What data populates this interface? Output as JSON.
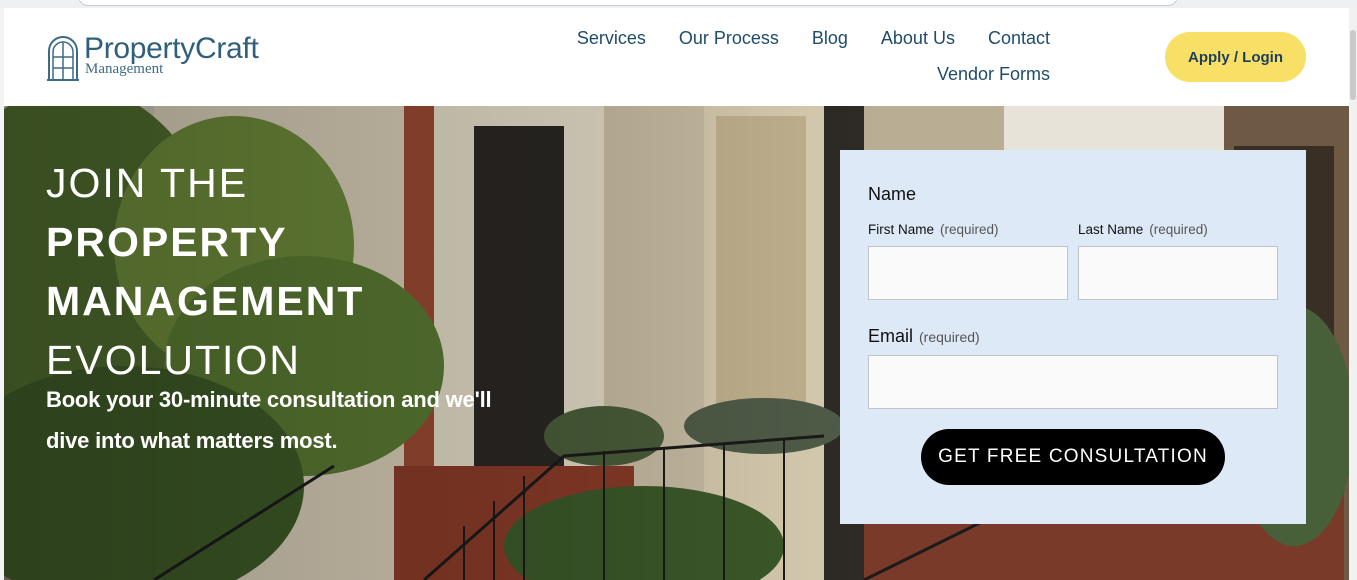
{
  "brand": {
    "name": "PropertyCraft",
    "subtitle": "Management",
    "logo_icon": "window-arch-icon"
  },
  "nav": {
    "row1": [
      "Services",
      "Our Process",
      "Blog",
      "About Us",
      "Contact"
    ],
    "row2": [
      "Vendor Forms"
    ]
  },
  "header": {
    "cta_label": "Apply / Login"
  },
  "hero": {
    "headline_line1": "JOIN THE",
    "headline_line2": "PROPERTY",
    "headline_line3": "MANAGEMENT",
    "headline_line4": "EVOLUTION",
    "subheading_line1": "Book your 30-minute consultation and we'll",
    "subheading_line2": "dive into what matters most."
  },
  "form": {
    "name_group_label": "Name",
    "first_name_label": "First Name",
    "last_name_label": "Last Name",
    "email_label": "Email",
    "required_text": "(required)",
    "first_name_value": "",
    "last_name_value": "",
    "email_value": "",
    "submit_label": "GET FREE CONSULTATION"
  },
  "colors": {
    "brand_blue": "#2f5f7d",
    "nav_text": "#1f4c6b",
    "cta_yellow": "#f8df66",
    "form_bg": "#dde9f6",
    "submit_bg": "#000000"
  }
}
